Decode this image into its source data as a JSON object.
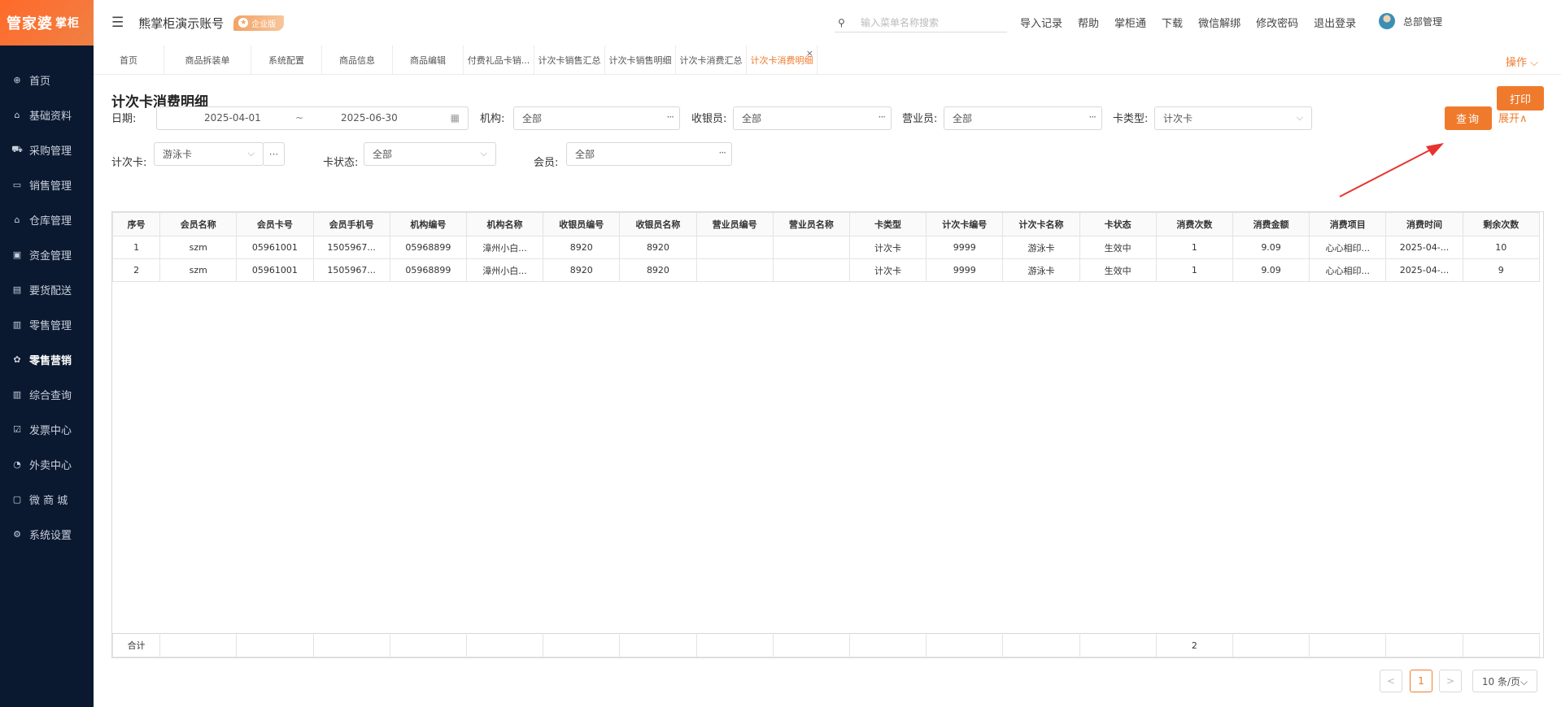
{
  "logo": {
    "main": "管家婆",
    "sub": "掌柜"
  },
  "sidebar": {
    "items": [
      {
        "label": "首页",
        "icon": "globe-icon"
      },
      {
        "label": "基础资料",
        "icon": "home-icon"
      },
      {
        "label": "采购管理",
        "icon": "cart-icon"
      },
      {
        "label": "销售管理",
        "icon": "sales-icon"
      },
      {
        "label": "仓库管理",
        "icon": "warehouse-icon"
      },
      {
        "label": "资金管理",
        "icon": "money-icon"
      },
      {
        "label": "要货配送",
        "icon": "delivery-icon"
      },
      {
        "label": "零售管理",
        "icon": "chart-icon"
      },
      {
        "label": "零售营销",
        "icon": "gift-icon"
      },
      {
        "label": "综合查询",
        "icon": "query-icon"
      },
      {
        "label": "发票中心",
        "icon": "invoice-icon"
      },
      {
        "label": "外卖中心",
        "icon": "takeaway-icon"
      },
      {
        "label": "微 商 城",
        "icon": "bag-icon"
      },
      {
        "label": "系统设置",
        "icon": "gear-icon"
      }
    ],
    "active_index": 8
  },
  "header": {
    "account": "熊掌柜演示账号",
    "badge": "企业版",
    "search_placeholder": "输入菜单名称搜索",
    "links": [
      "导入记录",
      "帮助",
      "掌柜通",
      "下载",
      "微信解绑",
      "修改密码",
      "退出登录"
    ],
    "user": "总部管理"
  },
  "tabs": {
    "items": [
      "首页",
      "商品拆装单",
      "系统配置",
      "商品信息",
      "商品编辑",
      "付费礼品卡销...",
      "计次卡销售汇总",
      "计次卡销售明细",
      "计次卡消费汇总",
      "计次卡消费明细"
    ],
    "active_index": 9,
    "close_glyph": "×",
    "operation": "操作 ⌵"
  },
  "page": {
    "title": "计次卡消费明细",
    "print_label": "打印"
  },
  "filters": {
    "date_label": "日期:",
    "date_start": "2025-04-01",
    "date_sep": "~",
    "date_end": "2025-06-30",
    "org_label": "机构:",
    "org_value": "全部",
    "cashier_label": "收银员:",
    "cashier_value": "全部",
    "sales_label": "营业员:",
    "sales_value": "全部",
    "cardtype_label": "卡类型:",
    "cardtype_value": "计次卡",
    "query_label": "查询",
    "expand_label": "展开∧",
    "card_label": "计次卡:",
    "card_value": "游泳卡",
    "status_label": "卡状态:",
    "status_value": "全部",
    "member_label": "会员:",
    "member_value": "全部",
    "more_glyph": "···"
  },
  "table": {
    "headers": [
      "序号",
      "会员名称",
      "会员卡号",
      "会员手机号",
      "机构编号",
      "机构名称",
      "收银员编号",
      "收银员名称",
      "营业员编号",
      "营业员名称",
      "卡类型",
      "计次卡编号",
      "计次卡名称",
      "卡状态",
      "消费次数",
      "消费金额",
      "消费项目",
      "消费时间",
      "剩余次数"
    ],
    "rows": [
      [
        "1",
        "szm",
        "05961001",
        "1505967...",
        "05968899",
        "漳州小白...",
        "8920",
        "8920",
        "",
        "",
        "计次卡",
        "9999",
        "游泳卡",
        "生效中",
        "1",
        "9.09",
        "心心相印...",
        "2025-04-...",
        "10"
      ],
      [
        "2",
        "szm",
        "05961001",
        "1505967...",
        "05968899",
        "漳州小白...",
        "8920",
        "8920",
        "",
        "",
        "计次卡",
        "9999",
        "游泳卡",
        "生效中",
        "1",
        "9.09",
        "心心相印...",
        "2025-04-...",
        "9"
      ]
    ],
    "summary": [
      "合计",
      "",
      "",
      "",
      "",
      "",
      "",
      "",
      "",
      "",
      "",
      "",
      "",
      "",
      "2",
      "",
      "",
      "",
      ""
    ]
  },
  "pagination": {
    "prev": "<",
    "current": "1",
    "next": ">",
    "page_size": "10 条/页⌵"
  },
  "colors": {
    "accent": "#f07a2c",
    "sidebar_bg": "#0b1930",
    "annotation_arrow": "#e8332e"
  }
}
